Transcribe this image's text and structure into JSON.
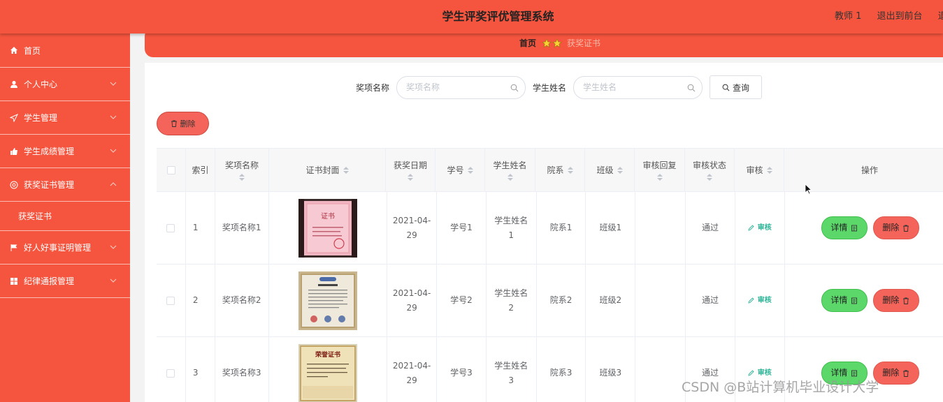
{
  "header": {
    "title": "学生评奖评优管理系统",
    "user_name": "教师 1",
    "exit_front_label": "退出到前台",
    "logout_label": "退"
  },
  "sidebar": {
    "items": [
      {
        "label": "首页",
        "icon": "home-icon",
        "expandable": false
      },
      {
        "label": "个人中心",
        "icon": "user-icon",
        "expandable": true
      },
      {
        "label": "学生管理",
        "icon": "send-icon",
        "expandable": true
      },
      {
        "label": "学生成绩管理",
        "icon": "thumb-icon",
        "expandable": true
      },
      {
        "label": "获奖证书管理",
        "icon": "help-icon",
        "expandable": true,
        "expanded": true,
        "children": [
          {
            "label": "获奖证书"
          }
        ]
      },
      {
        "label": "好人好事证明管理",
        "icon": "flag-icon",
        "expandable": true
      },
      {
        "label": "纪律通报管理",
        "icon": "grid-icon",
        "expandable": true
      }
    ]
  },
  "breadcrumb": {
    "home": "首页",
    "current": "获奖证书"
  },
  "search": {
    "award_label": "奖项名称",
    "award_placeholder": "奖项名称",
    "student_label": "学生姓名",
    "student_placeholder": "学生姓名",
    "query_label": "查询"
  },
  "toolbar": {
    "delete_label": "删除"
  },
  "table": {
    "columns": [
      {
        "label": "索引"
      },
      {
        "label": "奖项名称"
      },
      {
        "label": "证书封面"
      },
      {
        "label": "获奖日期"
      },
      {
        "label": "学号"
      },
      {
        "label": "学生姓名"
      },
      {
        "label": "院系"
      },
      {
        "label": "班级"
      },
      {
        "label": "审核回复"
      },
      {
        "label": "审核状态"
      },
      {
        "label": "审核"
      },
      {
        "label": "操作"
      }
    ],
    "rows": [
      {
        "index": "1",
        "award": "奖项名称1",
        "date_line1": "2021-04-",
        "date_line2": "29",
        "student_no": "学号1",
        "name_line1": "学生姓名",
        "name_line2": "1",
        "dept": "院系1",
        "class": "班级1",
        "reply": "",
        "status": "通过",
        "audit": "审核",
        "detail": "详情",
        "delete": "删除"
      },
      {
        "index": "2",
        "award": "奖项名称2",
        "date_line1": "2021-04-",
        "date_line2": "29",
        "student_no": "学号2",
        "name_line1": "学生姓名",
        "name_line2": "2",
        "dept": "院系2",
        "class": "班级2",
        "reply": "",
        "status": "通过",
        "audit": "审核",
        "detail": "详情",
        "delete": "删除"
      },
      {
        "index": "3",
        "award": "奖项名称3",
        "date_line1": "2021-04-",
        "date_line2": "29",
        "student_no": "学号3",
        "name_line1": "学生姓名",
        "name_line2": "3",
        "dept": "院系3",
        "class": "班级3",
        "reply": "",
        "status": "通过",
        "audit": "审核",
        "detail": "详情",
        "delete": "删除"
      }
    ]
  },
  "cert_images": {
    "cert1_title": "证书",
    "cert3_title": "荣誉证书"
  },
  "watermark": "CSDN @B站计算机毕业设计大学",
  "colors": {
    "primary": "#f5553e",
    "detail_button": "#5cd86a",
    "delete_button": "#f5645a",
    "audit_link": "#2bb597"
  }
}
